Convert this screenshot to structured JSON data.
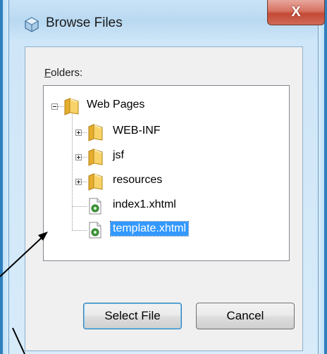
{
  "dialog": {
    "title": "Browse Files",
    "close_label": "X"
  },
  "folders": {
    "label_accel": "F",
    "label_rest": "olders:"
  },
  "tree": {
    "items": [
      {
        "label": "Web Pages",
        "type": "folder",
        "expander": "minus",
        "selected": false
      },
      {
        "label": "WEB-INF",
        "type": "folder",
        "expander": "plus",
        "selected": false
      },
      {
        "label": "jsf",
        "type": "folder",
        "expander": "plus",
        "selected": false
      },
      {
        "label": "resources",
        "type": "folder",
        "expander": "plus",
        "selected": false
      },
      {
        "label": "index1.xhtml",
        "type": "file",
        "expander": "none",
        "selected": false
      },
      {
        "label": "template.xhtml",
        "type": "file",
        "expander": "none",
        "selected": true
      }
    ]
  },
  "buttons": {
    "select_file": "Select File",
    "cancel": "Cancel"
  },
  "colors": {
    "selection": "#3399ff",
    "close_red": "#c44a36",
    "folder_yellow": "#f0c04a",
    "window_blue": "#2f7fbf"
  }
}
